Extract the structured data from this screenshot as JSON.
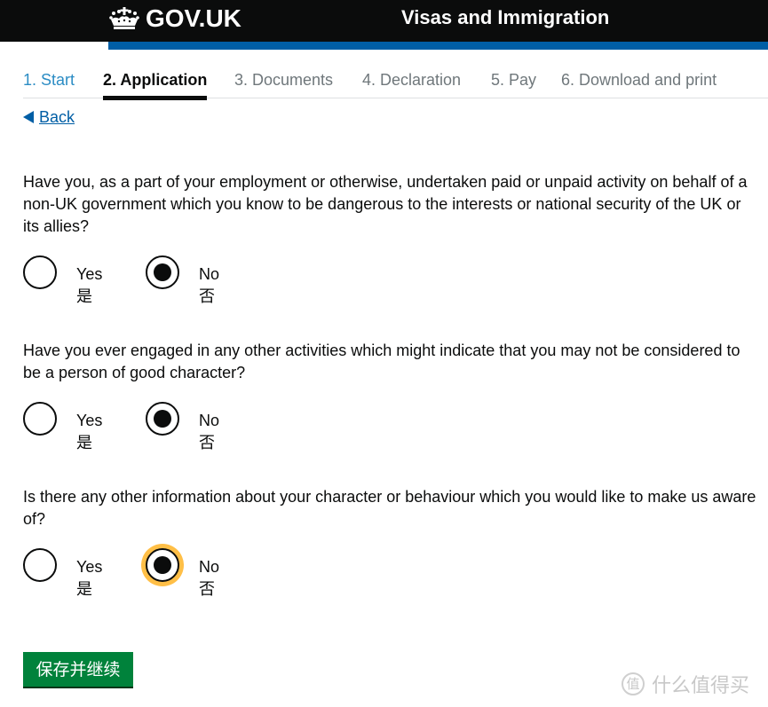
{
  "header": {
    "logo_text": "GOV.UK",
    "service_name": "Visas and Immigration",
    "brand_color": "#0b0c0c",
    "accent_color": "#005ea5"
  },
  "steps": [
    {
      "label": "1. Start",
      "state": "done"
    },
    {
      "label": "2. Application",
      "state": "current"
    },
    {
      "label": "3. Documents",
      "state": "upcoming"
    },
    {
      "label": "4. Declaration",
      "state": "upcoming"
    },
    {
      "label": "5. Pay",
      "state": "upcoming"
    },
    {
      "label": "6. Download and print",
      "state": "upcoming"
    }
  ],
  "back_link": {
    "label": "Back",
    "icon": "triangle-left-icon"
  },
  "questions": [
    {
      "text": "Have you, as a part of your employment or otherwise, undertaken paid or unpaid activity on behalf of a non-UK government which you know to be dangerous to the interests or national security of the UK or its allies?",
      "options": [
        {
          "label": "Yes",
          "label_zh": "是",
          "selected": false
        },
        {
          "label": "No",
          "label_zh": "否",
          "selected": true
        }
      ]
    },
    {
      "text": "Have you ever engaged in any other activities which might indicate that you may not be considered to be a person of good character?",
      "options": [
        {
          "label": "Yes",
          "label_zh": "是",
          "selected": false
        },
        {
          "label": "No",
          "label_zh": "否",
          "selected": true
        }
      ]
    },
    {
      "text": "Is there any other information about your character or behaviour which you would like to make us aware of?",
      "options": [
        {
          "label": "Yes",
          "label_zh": "是",
          "selected": false
        },
        {
          "label": "No",
          "label_zh": "否",
          "selected": true,
          "focused": true
        }
      ]
    }
  ],
  "submit_button": {
    "label": "保存并继续",
    "color": "#00823b"
  },
  "watermark": {
    "badge": "值",
    "text": "什么值得买"
  }
}
